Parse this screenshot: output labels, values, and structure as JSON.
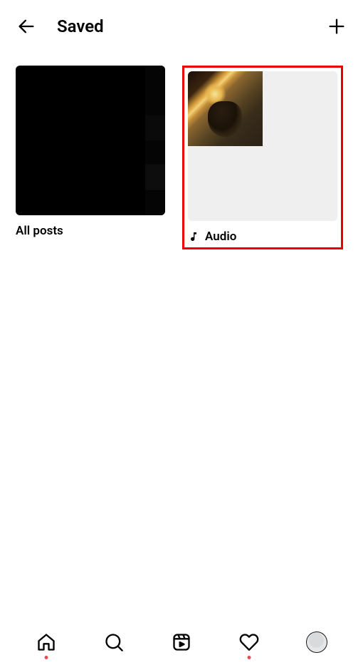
{
  "header": {
    "title": "Saved"
  },
  "collections": {
    "all_posts": {
      "label": "All posts"
    },
    "audio": {
      "label": "Audio"
    }
  },
  "highlight": {
    "target": "audio",
    "color": "#ea0000"
  }
}
